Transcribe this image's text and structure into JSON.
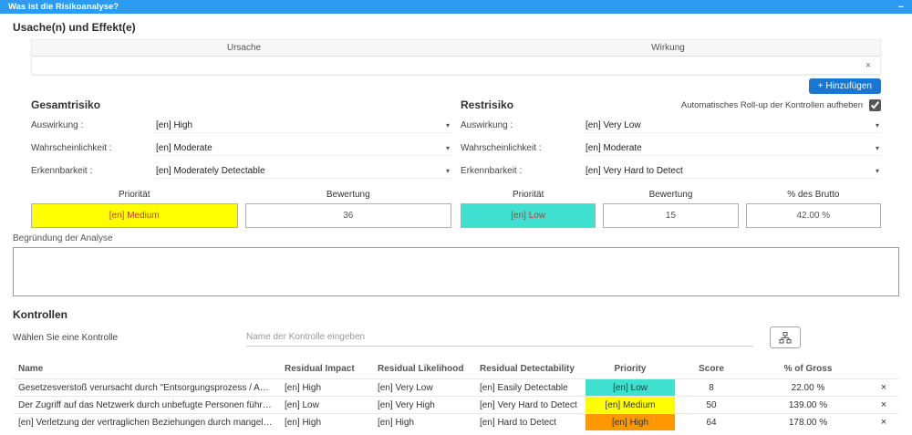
{
  "colors": {
    "titlebar_blue": "#2b9cf2",
    "button_blue": "#1976d2",
    "priority_text": "#c0392b",
    "priority_low": "#40e0d0",
    "priority_medium": "#ffff00",
    "priority_high": "#ff9800"
  },
  "icons": {
    "minimize": "−",
    "close": "×",
    "dropdown_caret": "▾"
  },
  "window": {
    "title": "Was ist die Risikoanalyse?"
  },
  "cause_effect": {
    "heading": "Usache(n) und Effekt(e)",
    "columns": {
      "cause": "Ursache",
      "effect": "Wirkung"
    },
    "add_button": "+ Hinzufügen"
  },
  "gross_risk": {
    "heading": "Gesamtrisiko",
    "fields": [
      {
        "label": "Auswirkung :",
        "value": "[en] High"
      },
      {
        "label": "Wahrscheinlichkeit :",
        "value": "[en] Moderate"
      },
      {
        "label": "Erkennbarkeit :",
        "value": "[en] Moderately Detectable"
      }
    ],
    "priority_header": "Priorität",
    "priority_value": "[en] Medium",
    "priority_color": "#ffff00",
    "score_header": "Bewertung",
    "score_value": "36"
  },
  "residual_risk": {
    "heading": "Restrisiko",
    "rollup_label": "Automatisches Roll-up der Kontrollen aufheben",
    "rollup_checked": true,
    "fields": [
      {
        "label": "Auswirkung :",
        "value": "[en] Very Low"
      },
      {
        "label": "Wahrscheinlichkeit :",
        "value": "[en] Moderate"
      },
      {
        "label": "Erkennbarkeit :",
        "value": "[en] Very Hard to Detect"
      }
    ],
    "priority_header": "Priorität",
    "priority_value": "[en] Low",
    "priority_color": "#40e0d0",
    "score_header": "Bewertung",
    "score_value": "15",
    "percent_header": "% des Brutto",
    "percent_value": "42.00 %"
  },
  "justification": {
    "label": "Begründung der Analyse",
    "value": ""
  },
  "controls": {
    "heading": "Kontrollen",
    "select_label": "Wählen Sie eine Kontrolle",
    "input_placeholder": "Name der Kontrolle eingeben",
    "columns": [
      "Name",
      "Residual Impact",
      "Residual Likelihood",
      "Residual Detectability",
      "Priority",
      "Score",
      "% of Gross"
    ],
    "rows": [
      {
        "name": "Gesetzesverstoß verursacht durch \"Entsorgungsprozess / Anweisung\" Ungehorsam",
        "impact": "[en] High",
        "likelihood": "[en] Very Low",
        "detectability": "[en] Easily Detectable",
        "priority": "[en] Low",
        "priority_color": "#40e0d0",
        "score": "8",
        "percent": "22.00 %"
      },
      {
        "name": "Der Zugriff auf das Netzwerk durch unbefugte Personen führt dazu, dass von Clients sch...",
        "impact": "[en] Low",
        "likelihood": "[en] Very High",
        "detectability": "[en] Very Hard to Detect",
        "priority": "[en] Medium",
        "priority_color": "#ffff00",
        "score": "50",
        "percent": "139.00 %"
      },
      {
        "name": "[en] Verletzung der vertraglichen Beziehungen durch mangelndes Bewusstsein der Kund...",
        "impact": "[en] High",
        "likelihood": "[en] High",
        "detectability": "[en] Hard to Detect",
        "priority": "[en] High",
        "priority_color": "#ff9800",
        "score": "64",
        "percent": "178.00 %"
      }
    ]
  }
}
